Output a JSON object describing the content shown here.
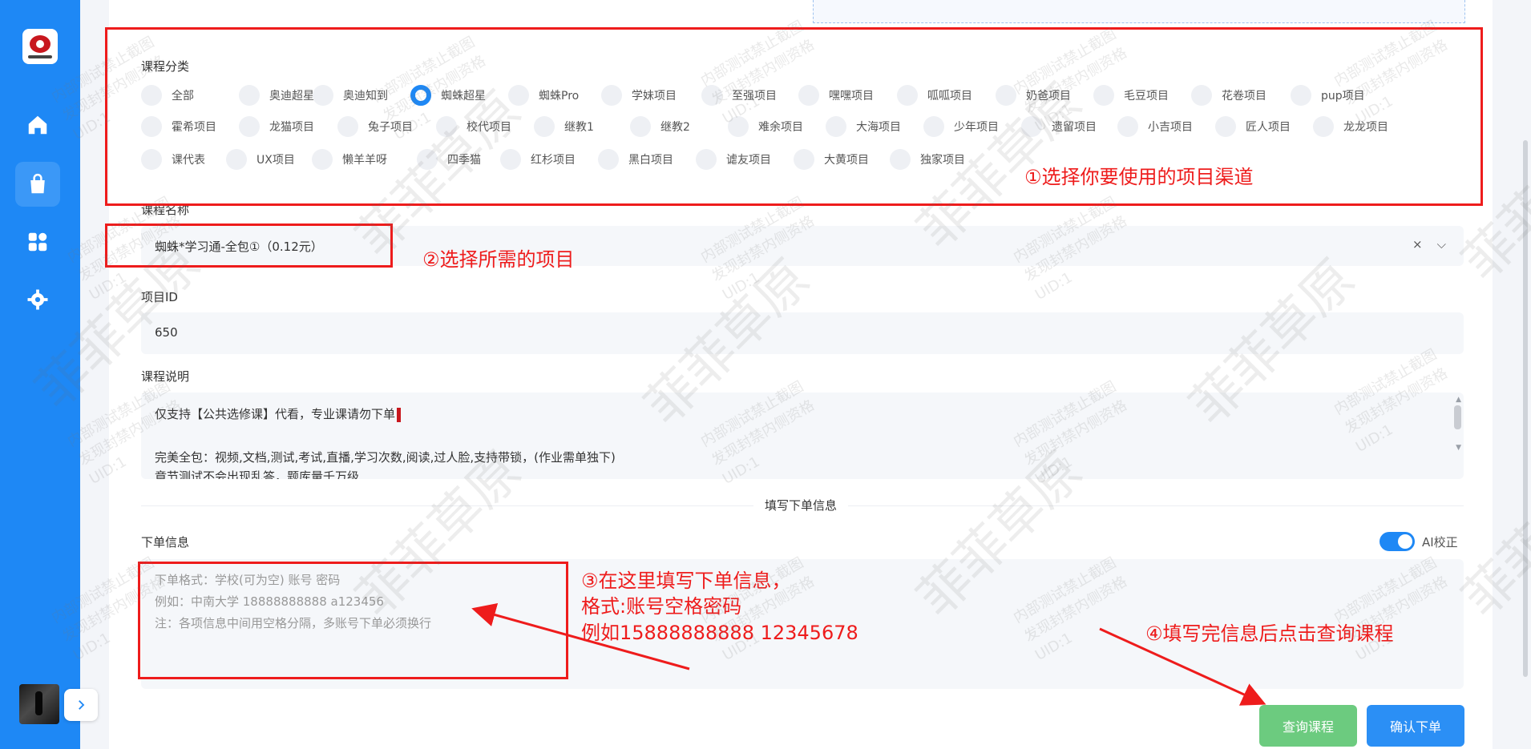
{
  "sidebar": {
    "nav": [
      {
        "icon": "home-icon"
      },
      {
        "icon": "shopping-bag-icon"
      },
      {
        "icon": "grid-icon"
      },
      {
        "icon": "gear-icon"
      }
    ],
    "collapse_icon": "chevron-right-icon"
  },
  "form": {
    "category_label": "课程分类",
    "categories": [
      "全部",
      "奥迪超星",
      "奥迪知到",
      "蜘蛛超星",
      "蜘蛛Pro",
      "学妹项目",
      "至强项目",
      "嘿嘿项目",
      "呱呱项目",
      "奶爸项目",
      "毛豆项目",
      "花卷项目",
      "pup项目",
      "霍希项目",
      "龙猫项目",
      "兔子项目",
      "校代项目",
      "继教1",
      "继教2",
      "难余项目",
      "大海项目",
      "少年项目",
      "遗留项目",
      "小吉项目",
      "匠人项目",
      "龙龙项目",
      "课代表",
      "UX项目",
      "懒羊羊呀",
      "四季猫",
      "红杉项目",
      "黑白项目",
      "谑友项目",
      "大黄项目",
      "独家项目"
    ],
    "selected_category": "蜘蛛超星",
    "course_name_label": "课程名称",
    "course_name_value": "蜘蛛*学习通-全包①（0.12元）",
    "project_id_label": "项目ID",
    "project_id_value": "650",
    "description_label": "课程说明",
    "description_lines": [
      "仅支持【公共选修课】代看，专业课请勿下单",
      "",
      "完美全包：视频,文档,测试,考试,直播,学习次数,阅读,过人脸,支持带锁，(作业需单独下)",
      "章节测试不会出现乱答，题库量千万级"
    ],
    "section_title": "填写下单信息",
    "order_info_label": "下单信息",
    "ai_toggle_label": "AI校正",
    "ai_toggle_on": true,
    "order_placeholder_lines": [
      "下单格式：学校(可为空) 账号 密码",
      "例如：中南大学 18888888888 a123456",
      "注：各项信息中间用空格分隔，多账号下单必须换行"
    ],
    "query_button": "查询课程",
    "confirm_button": "确认下单"
  },
  "annotations": {
    "step1": "①选择你要使用的项目渠道",
    "step2": "②选择所需的项目",
    "step3_lines": [
      "③在这里填写下单信息，",
      "格式:账号空格密码",
      "例如15888888888 12345678"
    ],
    "step4": "④填写完信息后点击查询课程"
  },
  "watermark": {
    "lines": [
      "内部测试禁止截图",
      "发现封禁内侧资格",
      "UID:1"
    ],
    "big_text": "菲菲草原"
  },
  "colors": {
    "sidebar": "#1e88f5",
    "annotation_red": "#ee1c1c",
    "query_green": "#6ccb7f",
    "confirm_blue": "#2b8ff5"
  }
}
